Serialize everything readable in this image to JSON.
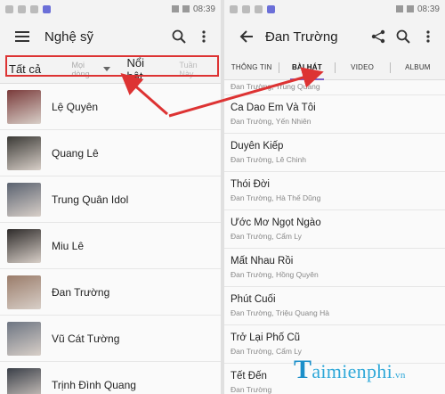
{
  "status": {
    "time": "08:39"
  },
  "left": {
    "title": "Nghệ sỹ",
    "filters": {
      "all": "Tất cả",
      "genre": "Mọi dòng",
      "featured": "Nổi bật",
      "week": "Tuần Này"
    },
    "artists": [
      {
        "name": "Lệ Quyên",
        "color": "#7a3b3b"
      },
      {
        "name": "Quang Lê",
        "color": "#3b3a36"
      },
      {
        "name": "Trung Quân Idol",
        "color": "#5a6270"
      },
      {
        "name": "Miu Lê",
        "color": "#2e2b2a"
      },
      {
        "name": "Đan Trường",
        "color": "#9a7c6a"
      },
      {
        "name": "Vũ Cát Tường",
        "color": "#6d7582"
      },
      {
        "name": "Trịnh Đình Quang",
        "color": "#3a3f48"
      }
    ]
  },
  "right": {
    "title": "Đan Trường",
    "tabs": [
      "THÔNG TIN",
      "BÀI HÁT",
      "VIDEO",
      "ALBUM"
    ],
    "first_sub": "Đan Trường, Trung Quang",
    "songs": [
      {
        "title": "Ca Dao Em Và Tôi",
        "artists": "Đan Trường, Yến Nhiên"
      },
      {
        "title": "Duyên Kiếp",
        "artists": "Đan Trường, Lê Chinh"
      },
      {
        "title": "Thói Đời",
        "artists": "Đan Trường, Hà Thế Dũng"
      },
      {
        "title": "Ước Mơ Ngọt Ngào",
        "artists": "Đan Trường, Cẩm Ly"
      },
      {
        "title": "Mất Nhau Rồi",
        "artists": "Đan Trường, Hồng Quyên"
      },
      {
        "title": "Phút Cuối",
        "artists": "Đan Trường, Triệu Quang Hà"
      },
      {
        "title": "Trở Lại Phố Cũ",
        "artists": "Đan Trường, Cẩm Ly"
      },
      {
        "title": "Tết Đến",
        "artists": "Đan Trường"
      }
    ]
  },
  "watermark": {
    "first": "T",
    "rest": "aimienphi",
    "suffix": ".vn"
  },
  "colors": {
    "accent": "#7b5fc7",
    "annotation": "#d33333",
    "watermark": "#2fa8d8"
  }
}
